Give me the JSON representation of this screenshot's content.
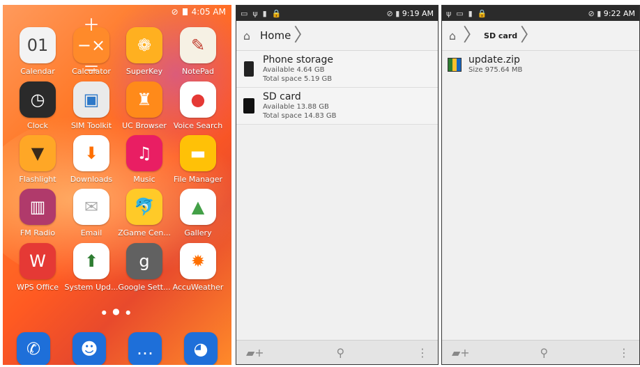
{
  "home": {
    "status_time": "4:05 AM",
    "apps": [
      {
        "label": "Calendar",
        "glyph": "01",
        "bg": "#f3f3f3",
        "fg": "#444"
      },
      {
        "label": "Calculator",
        "glyph": "＋−×＝",
        "bg": "#ff8a2a",
        "fg": "#fff"
      },
      {
        "label": "SuperKey",
        "glyph": "❁",
        "bg": "#ffb020",
        "fg": "#fff"
      },
      {
        "label": "NotePad",
        "glyph": "✎",
        "bg": "#f6f1e4",
        "fg": "#c0392b"
      },
      {
        "label": "Clock",
        "glyph": "◷",
        "bg": "#2a2a2a",
        "fg": "#fff"
      },
      {
        "label": "SIM Toolkit",
        "glyph": "▣",
        "bg": "#eaeaea",
        "fg": "#2d78c8"
      },
      {
        "label": "UC Browser",
        "glyph": "♜",
        "bg": "#ff8a1a",
        "fg": "#fff"
      },
      {
        "label": "Voice Search",
        "glyph": "●",
        "bg": "#ffffff",
        "fg": "#e53935"
      },
      {
        "label": "Flashlight",
        "glyph": "▼",
        "bg": "#ffa726",
        "fg": "#3a2a1a"
      },
      {
        "label": "Downloads",
        "glyph": "⬇",
        "bg": "#ffffff",
        "fg": "#ff6f00"
      },
      {
        "label": "Music",
        "glyph": "♫",
        "bg": "#e91e63",
        "fg": "#fff"
      },
      {
        "label": "File Manager",
        "glyph": "▬",
        "bg": "#ffc107",
        "fg": "#fff"
      },
      {
        "label": "FM Radio",
        "glyph": "▥",
        "bg": "#b03a6b",
        "fg": "#fff"
      },
      {
        "label": "Email",
        "glyph": "✉",
        "bg": "#ffffff",
        "fg": "#aaa"
      },
      {
        "label": "ZGame Cen...",
        "glyph": "🐬",
        "bg": "#ffca28",
        "fg": "#1e88e5"
      },
      {
        "label": "Gallery",
        "glyph": "▲",
        "bg": "#ffffff",
        "fg": "#43a047"
      },
      {
        "label": "WPS Office",
        "glyph": "W",
        "bg": "#e53935",
        "fg": "#fff"
      },
      {
        "label": "System Upd...",
        "glyph": "⬆",
        "bg": "#ffffff",
        "fg": "#2e7d32"
      },
      {
        "label": "Google Sett...",
        "glyph": "g",
        "bg": "#616161",
        "fg": "#fff"
      },
      {
        "label": "AccuWeather",
        "glyph": "✹",
        "bg": "#ffffff",
        "fg": "#ff6f00"
      }
    ],
    "dock": [
      {
        "name": "phone-icon",
        "glyph": "✆",
        "bg": "#1e6fd9"
      },
      {
        "name": "contacts-icon",
        "glyph": "☻",
        "bg": "#1e6fd9"
      },
      {
        "name": "messaging-icon",
        "glyph": "…",
        "bg": "#1e6fd9"
      },
      {
        "name": "browser-icon",
        "glyph": "◕",
        "bg": "#1e6fd9"
      }
    ]
  },
  "storage_root": {
    "status_time": "9:19 AM",
    "breadcrumb": "Home",
    "items": [
      {
        "title": "Phone storage",
        "line1": "Available 4.64 GB",
        "line2": "Total space 5.19 GB"
      },
      {
        "title": "SD card",
        "line1": "Available 13.88 GB",
        "line2": "Total space 14.83 GB"
      }
    ]
  },
  "sd_card": {
    "status_time": "9:22 AM",
    "breadcrumb": "SD card",
    "items": [
      {
        "title": "update.zip",
        "line1": "Size 975.64 MB"
      }
    ]
  }
}
